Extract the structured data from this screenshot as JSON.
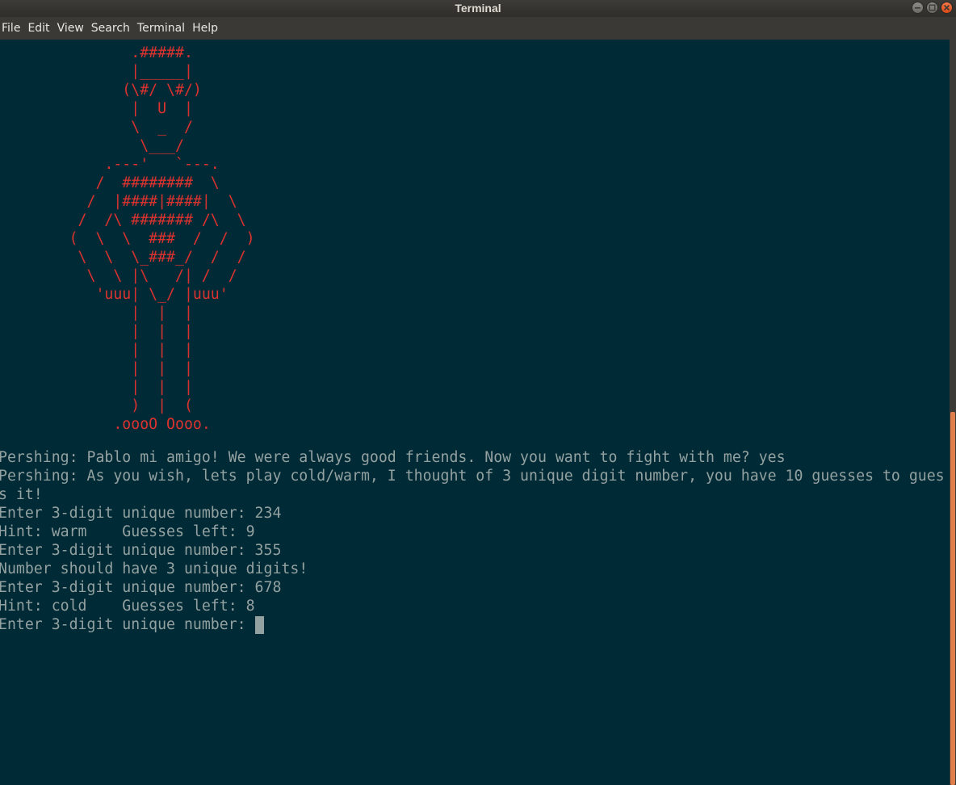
{
  "window": {
    "title": "Terminal",
    "minimize_icon": "minimize-icon",
    "maximize_icon": "maximize-icon",
    "close_icon": "close-icon"
  },
  "menubar": {
    "items": [
      {
        "label": "File"
      },
      {
        "label": "Edit"
      },
      {
        "label": "View"
      },
      {
        "label": "Search"
      },
      {
        "label": "Terminal"
      },
      {
        "label": "Help"
      }
    ]
  },
  "terminal": {
    "colors": {
      "background": "#002b36",
      "foreground": "#93a1a1",
      "art": "#dc322f",
      "scrollbar_thumb": "#e07e4b"
    },
    "ascii_art": "               .#####.\n               |_____|\n              (\\#/ \\#/)\n               |  U  |\n               \\  _  /\n                \\___/\n            .---'   `---.\n           /  ########  \\\n          /  |####|####|  \\\n         /  /\\ ####### /\\  \\\n        (  \\  \\  ###  /  /  )\n         \\  \\  \\_###_/  /  /\n          \\  \\ |\\   /| /  /\n           'uuu| \\_/ |uuu'\n               |  |  |\n               |  |  |\n               |  |  |\n               |  |  |\n               |  |  |\n               )  |  (\n             .oooO Oooo.",
    "transcript": "Pershing: Pablo mi amigo! We were always good friends. Now you want to fight with me? yes\nPershing: As you wish, lets play cold/warm, I thought of 3 unique digit number, you have 10 guesses to gues\ns it!\nEnter 3-digit unique number: 234\nHint: warm    Guesses left: 9\nEnter 3-digit unique number: 355\nNumber should have 3 unique digits!\nEnter 3-digit unique number: 678\nHint: cold    Guesses left: 8",
    "prompt": "Enter 3-digit unique number: "
  }
}
